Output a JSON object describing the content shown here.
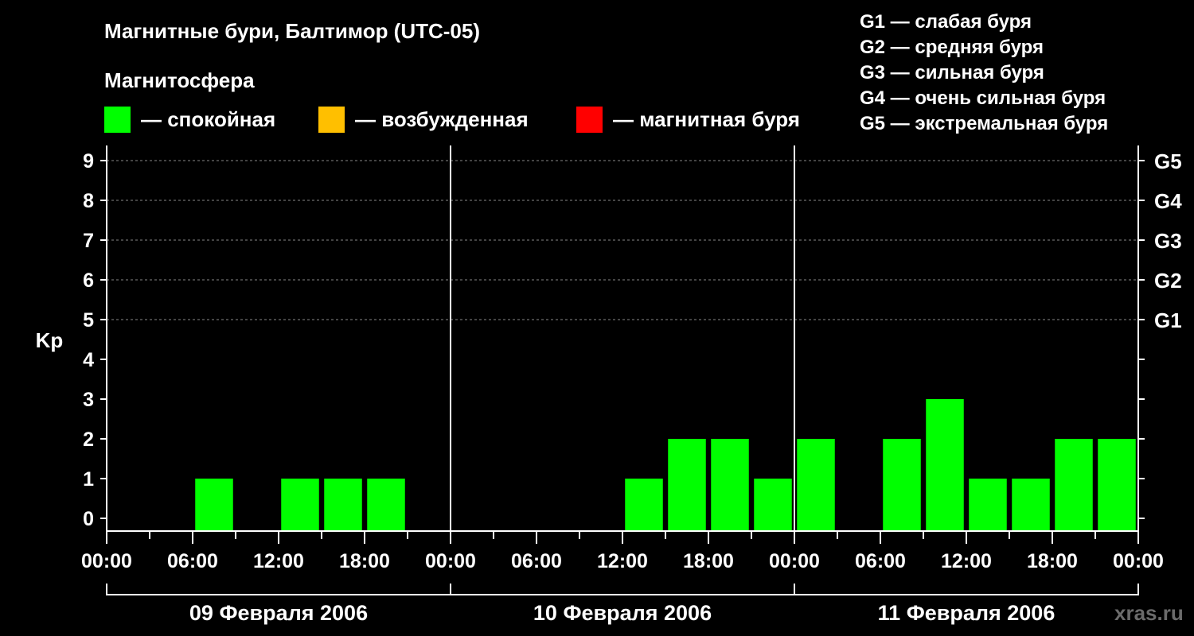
{
  "title": "Магнитные бури, Балтимор (UTC-05)",
  "magnetosphere_label": "Магнитосфера",
  "legend": [
    {
      "text": "— спокойная",
      "color": "#00ff00"
    },
    {
      "text": "— возбужденная",
      "color": "#ffbf00"
    },
    {
      "text": "— магнитная буря",
      "color": "#ff0000"
    }
  ],
  "g_scale": [
    "G1 — слабая буря",
    "G2 — средняя буря",
    "G3 — сильная буря",
    "G4 — очень сильная буря",
    "G5 — экстремальная буря"
  ],
  "watermark": "xras.ru",
  "chart_data": {
    "type": "bar",
    "ylabel": "Kp",
    "ylim": [
      0,
      9
    ],
    "yticks": [
      "0",
      "1",
      "2",
      "3",
      "4",
      "5",
      "6",
      "7",
      "8",
      "9"
    ],
    "right_ticks": [
      {
        "kp": 5,
        "label": "G1"
      },
      {
        "kp": 6,
        "label": "G2"
      },
      {
        "kp": 7,
        "label": "G3"
      },
      {
        "kp": 8,
        "label": "G4"
      },
      {
        "kp": 9,
        "label": "G5"
      }
    ],
    "grid": "dashed at Kp 5-9",
    "xticks": [
      "00:00",
      "06:00",
      "12:00",
      "18:00",
      "00:00",
      "06:00",
      "12:00",
      "18:00",
      "00:00",
      "06:00",
      "12:00",
      "18:00",
      "00:00"
    ],
    "days": [
      "09 Февраля 2006",
      "10 Февраля 2006",
      "11 Февраля 2006"
    ],
    "bar_color": "#00ff00",
    "interval_hours": 3,
    "series": [
      {
        "values": [
          0,
          0,
          1,
          0,
          1,
          1,
          1,
          0,
          0,
          0,
          0,
          0,
          1,
          2,
          2,
          1,
          2,
          0,
          2,
          3,
          1,
          1,
          2,
          2
        ]
      }
    ]
  }
}
